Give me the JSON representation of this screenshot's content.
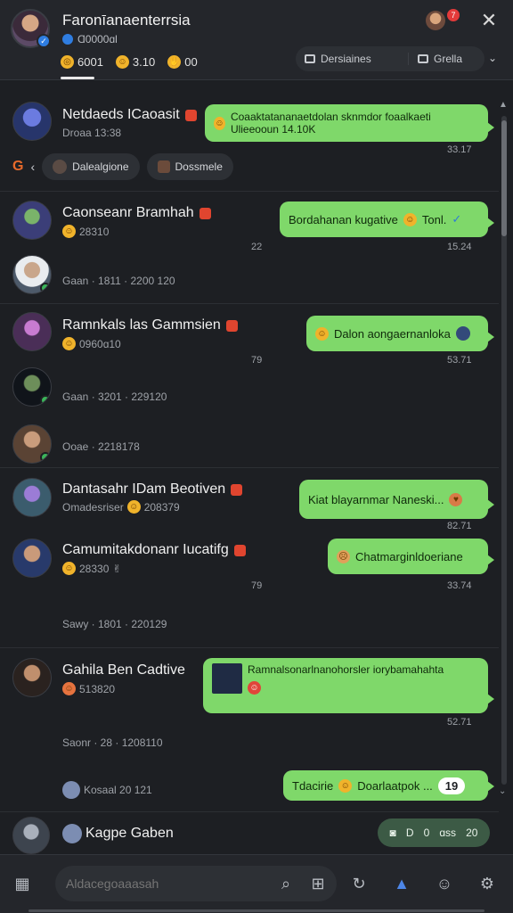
{
  "header": {
    "title": "Faronīanaenterrsia",
    "subtitle": "Ɑ0000ɑl",
    "stats": [
      {
        "icon": "gold-icon",
        "value": "6001"
      },
      {
        "icon": "smile-icon",
        "value": "3.10"
      },
      {
        "icon": "hand-icon",
        "value": "00"
      }
    ],
    "notif_count": "7",
    "pill_left": "Dersiaines",
    "pill_right": "Grella"
  },
  "chips": [
    {
      "label": "Dalealgione"
    },
    {
      "label": "Dossmele"
    }
  ],
  "chats": [
    {
      "name": "Netdaeds ICaoasit",
      "meta": "Droaa 13:38",
      "message": "Coaaktatananaetdolan sknmdor foaalkaeti Ulieeooun 14.10K",
      "time": "33.17"
    },
    {
      "name": "Caonseanr Bramhah",
      "meta": "28310",
      "message": "Bordahanan  kugative",
      "message_tail": "Tonl.",
      "count": "22",
      "time": "15.24"
    },
    {
      "meta": "Gaan · 1811 · 2200 120"
    },
    {
      "name": "Ramnkals las Gammsien",
      "meta": "0960ɑ10",
      "message": "Dalon aongaernanloka",
      "count": "79",
      "time": "53.71"
    },
    {
      "meta": "Gaan · 3201 · 229120"
    },
    {
      "meta": "Ooae · 2218178"
    },
    {
      "name": "Dantasahr IDam Beotiven",
      "meta": "Omadesriser",
      "meta_value": "208379",
      "message": "Kiat blayarnmar Naneski...",
      "time": "82.71"
    },
    {
      "name": "Camumitakdonanr Iucatifg",
      "meta": "28330",
      "message": "Chatmarginldoeriane",
      "count": "79",
      "time": "33.74"
    },
    {
      "meta": "Sawy · 1801 · 220129"
    },
    {
      "name": "Gahila Ben Cadtive",
      "meta": "513820",
      "message": "Ramnalsonarlnanohorsler iorybamahahta",
      "time": "52.71"
    },
    {
      "meta": "Saonr · 28 · 1208110"
    },
    {
      "meta": "Kosaal 20 121",
      "message": "Tdacirie",
      "message_tail": "Doarlaatpok ...",
      "badge": "19"
    },
    {
      "name": "Kagpe Gaben",
      "send_items": [
        "D",
        "0",
        "ɑss",
        "20"
      ]
    }
  ],
  "input": {
    "placeholder": "Aldacegoaaasah"
  }
}
